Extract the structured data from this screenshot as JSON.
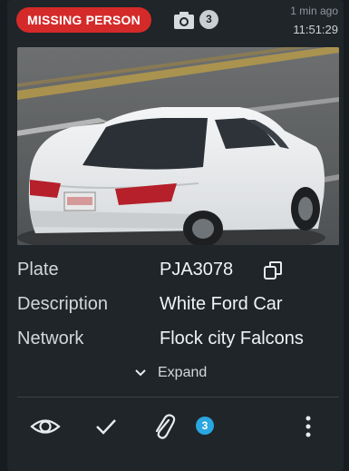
{
  "header": {
    "alert_badge": "MISSING PERSON",
    "image_count": "3",
    "relative_time": "1 min ago",
    "timestamp": "11:51:29"
  },
  "photo": {
    "description": "white sedan rear view"
  },
  "details": [
    {
      "label": "Plate",
      "value": "PJA3078"
    },
    {
      "label": "Description",
      "value": "White Ford Car"
    },
    {
      "label": "Network",
      "value": "Flock city Falcons"
    }
  ],
  "expand_label": "Expand",
  "footer": {
    "attachment_count": "3"
  },
  "colors": {
    "alert": "#d52a2a",
    "accent": "#2aa6e0",
    "card_bg": "#1f2529"
  },
  "icons": [
    "camera-icon",
    "copy-icon",
    "chevron-down-icon",
    "eye-icon",
    "check-icon",
    "paperclip-icon",
    "more-vertical-icon"
  ]
}
